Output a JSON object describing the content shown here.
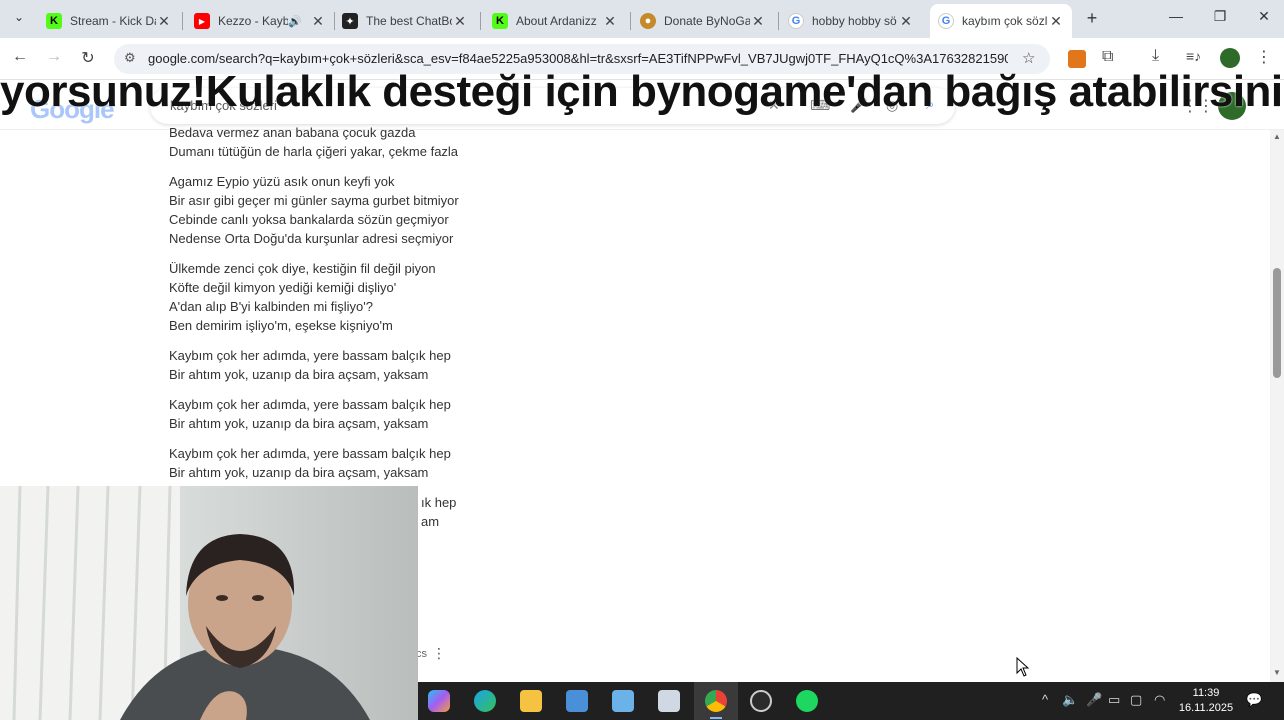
{
  "browser": {
    "tabs": [
      {
        "title": "Stream - Kick Da",
        "favicon": "kick-icon",
        "color": "#53fc18"
      },
      {
        "title": "Kezzo - Kayb",
        "favicon": "youtube-icon",
        "color": "#ff0000"
      },
      {
        "title": "The best ChatBo",
        "favicon": "chatbot-icon",
        "color": "#222222"
      },
      {
        "title": "About Ardanizz",
        "favicon": "kick-icon",
        "color": "#53fc18"
      },
      {
        "title": "Donate ByNoGa",
        "favicon": "bynogame-icon",
        "color": "#c58a2c"
      },
      {
        "title": "hobby hobby sö",
        "favicon": "google-icon",
        "color": "#4285f4"
      },
      {
        "title": "kaybım çok sözle",
        "favicon": "google-icon",
        "color": "#4285f4"
      }
    ],
    "url": "google.com/search?q=kaybım+çok+sözleri&sca_esv=f84ae5225a953008&hl=tr&sxsrf=AE3TifNPPwFvl_VB7JUgwj0TF_FHAyQ1cQ%3A17632821590..."
  },
  "overlay": {
    "banner": "yorsunuz!Kulaklık desteği için bynogame'dan bağış atabilirsiniz seviliy"
  },
  "google": {
    "logo": "Google",
    "query": "kaybım çok sözleri"
  },
  "lyrics": [
    [
      "Bedava vermez anan babana çocuk gazda",
      "Dumanı tütüğün de harla çiğeri yakar, çekme fazla"
    ],
    [
      "Agamız Eypio yüzü asık onun keyfi yok",
      "Bir asır gibi geçer mi günler sayma gurbet bitmiyor",
      "Cebinde canlı yoksa bankalarda sözün geçmiyor",
      "Nedense Orta Doğu'da kurşunlar adresi seçmiyor"
    ],
    [
      "Ülkemde zenci çok diye, kestiğin fil değil piyon",
      "Köfte değil kimyon yediği kemiği dişliyo'",
      "A'dan alıp B'yi kalbinden mi fişliyo'?",
      "Ben demirim işliyo'm, eşekse kişniyo'm"
    ],
    [
      "Kaybım çok her adımda, yere bassam balçık hep",
      "Bir ahtım yok, uzanıp da bira açsam, yaksam"
    ],
    [
      "Kaybım çok her adımda, yere bassam balçık hep",
      "Bir ahtım yok, uzanıp da bira açsam, yaksam"
    ],
    [
      "Kaybım çok her adımda, yere bassam balçık hep",
      "Bir ahtım yok, uzanıp da bira açsam, yaksam"
    ],
    [
      "ık hep",
      "am"
    ]
  ],
  "footer_text": "cs",
  "taskbar": {
    "time": "11:39",
    "date": "16.11.2025"
  }
}
